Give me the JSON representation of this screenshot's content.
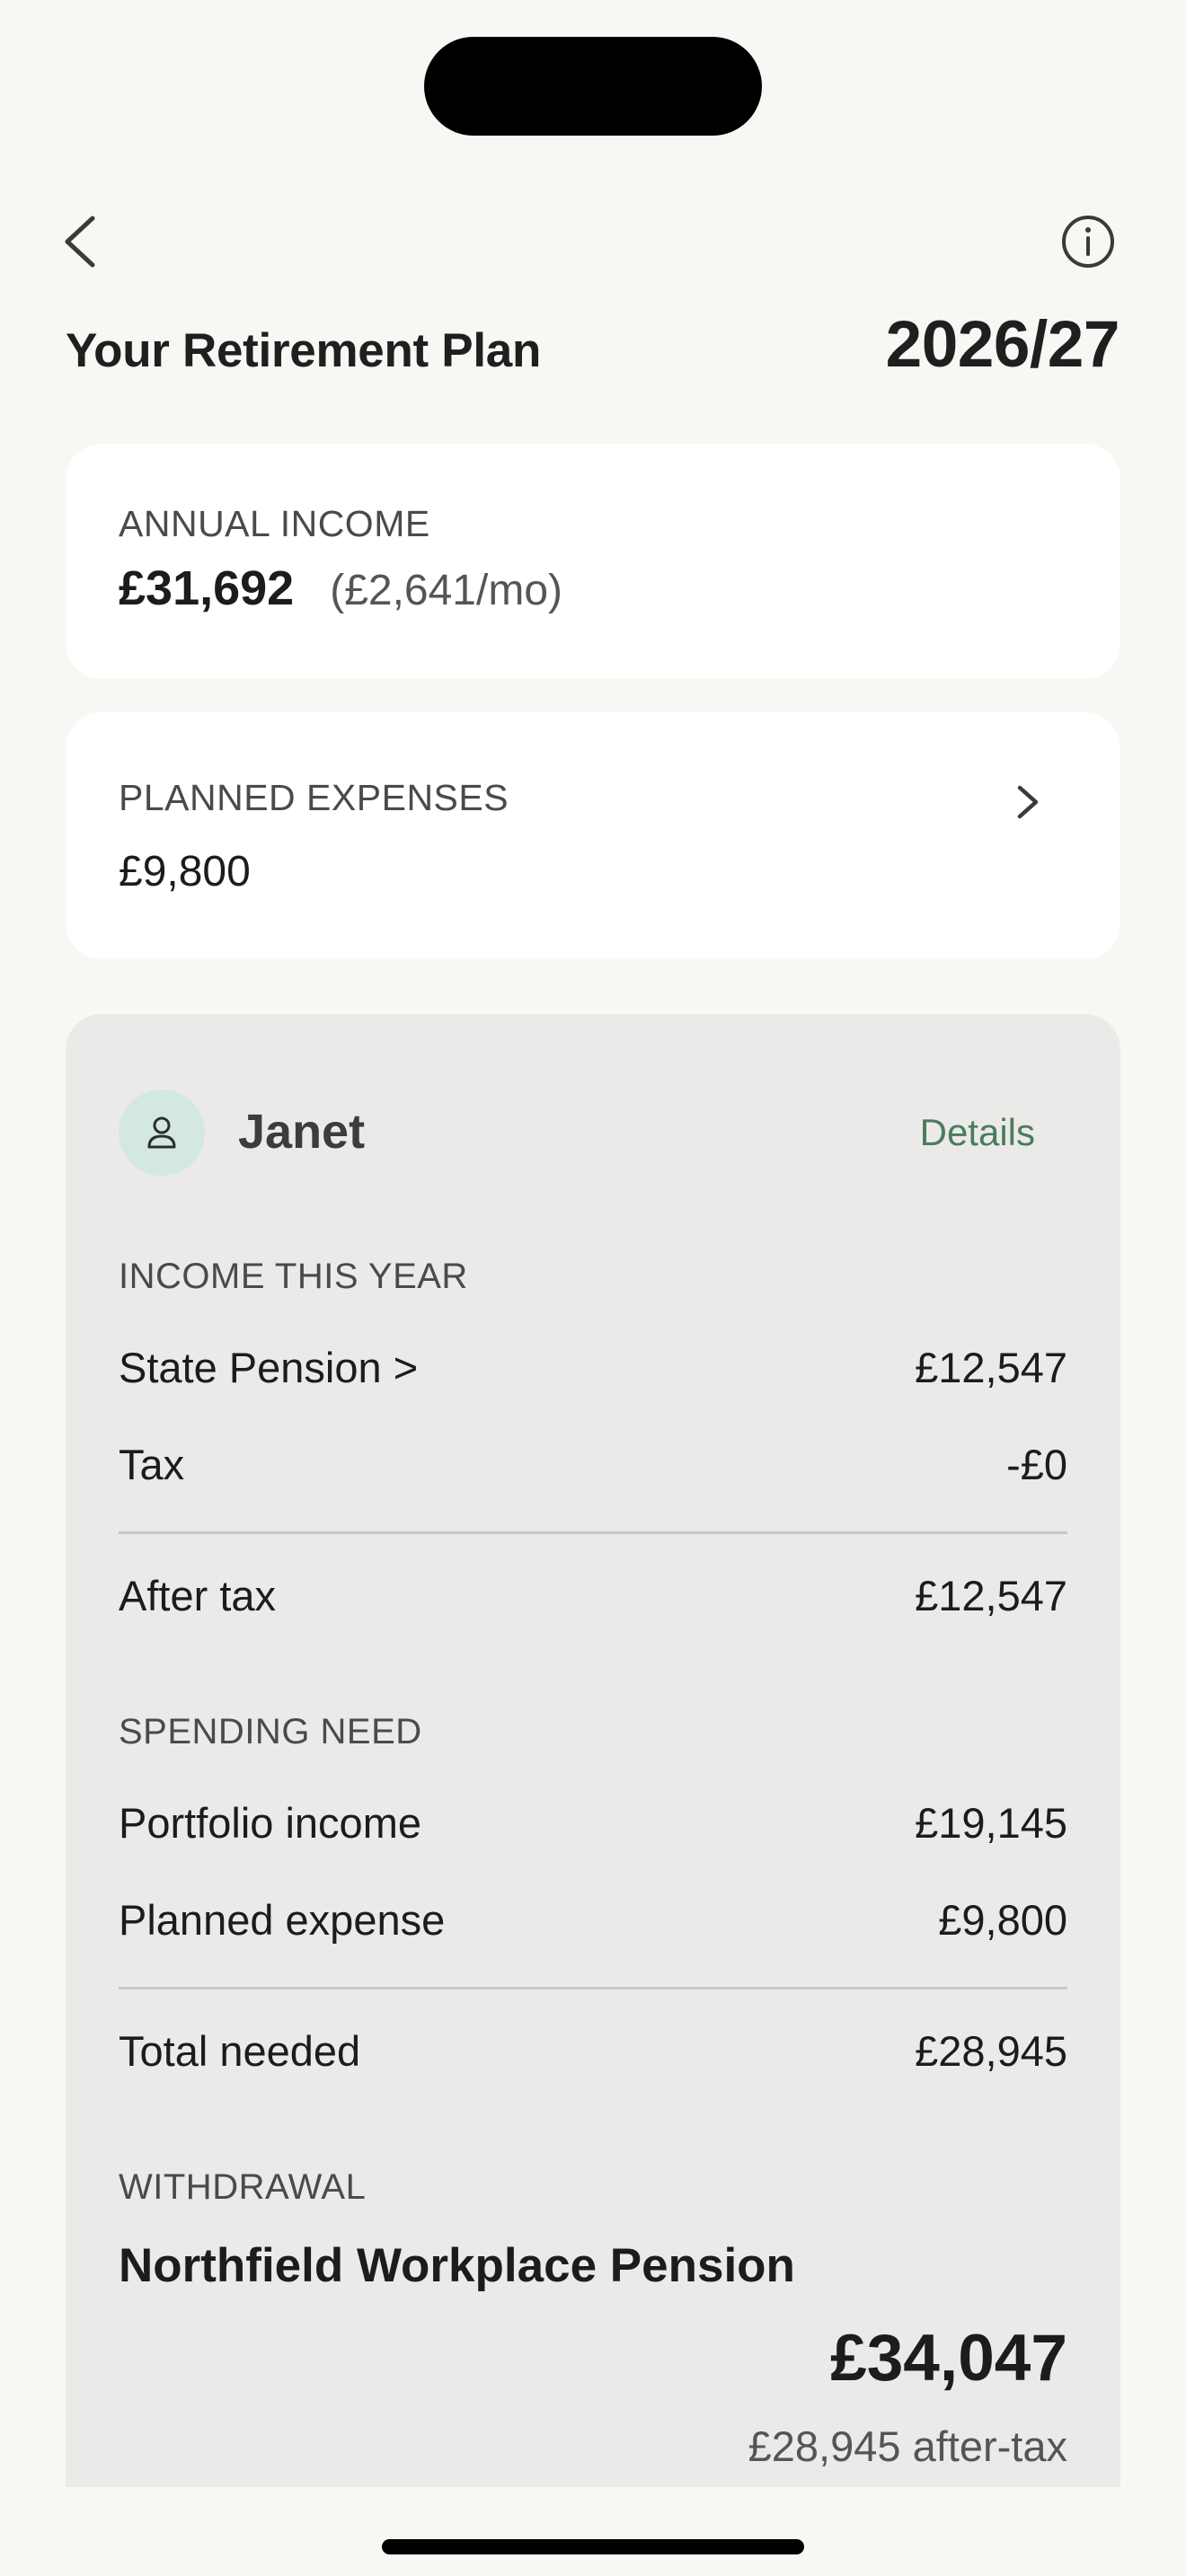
{
  "header": {
    "title": "Your Retirement Plan",
    "tax_year": "2026/27",
    "back_icon": "chevron-left-icon",
    "info_icon": "info-icon"
  },
  "annual_income": {
    "label": "ANNUAL INCOME",
    "value": "£31,692",
    "monthly": "(£2,641/mo)"
  },
  "planned_expenses": {
    "label": "PLANNED EXPENSES",
    "value": "£9,800",
    "chevron_icon": "chevron-right-icon"
  },
  "person": {
    "name": "Janet",
    "avatar_icon": "person-icon",
    "details_label": "Details",
    "income_section": {
      "label": "INCOME THIS YEAR",
      "rows": [
        {
          "label": "State Pension >",
          "value": "£12,547"
        },
        {
          "label": "Tax",
          "value": "-£0"
        }
      ],
      "total": {
        "label": "After tax",
        "value": "£12,547"
      }
    },
    "spending_section": {
      "label": "SPENDING NEED",
      "rows": [
        {
          "label": "Portfolio income",
          "value": "£19,145"
        },
        {
          "label": "Planned expense",
          "value": "£9,800"
        }
      ],
      "total": {
        "label": "Total needed",
        "value": "£28,945"
      }
    },
    "withdrawal": {
      "label": "WITHDRAWAL",
      "source": "Northfield Workplace Pension",
      "amount": "£34,047",
      "after_tax": "£28,945 after-tax"
    }
  },
  "colors": {
    "background": "#f8f7f4",
    "card": "#ffffff",
    "person_card": "#ebeae8",
    "accent_green": "#4a7c5c",
    "avatar_bg": "#d3e9df"
  }
}
